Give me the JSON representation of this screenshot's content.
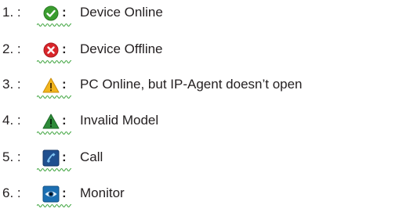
{
  "items": [
    {
      "number": "1. :",
      "icon": "check-circle-icon",
      "colon": ":",
      "label": "Device Online"
    },
    {
      "number": "2. :",
      "icon": "x-circle-icon",
      "colon": ":",
      "label": "Device Offline"
    },
    {
      "number": "3. :",
      "icon": "warning-icon",
      "colon": ":",
      "label": "PC Online, but IP-Agent doesn’t open"
    },
    {
      "number": "4. :",
      "icon": "invalid-model-icon",
      "colon": ":",
      "label": "Invalid Model"
    },
    {
      "number": "5. :",
      "icon": "phone-icon",
      "colon": ":",
      "label": "Call"
    },
    {
      "number": "6. :",
      "icon": "eye-icon",
      "colon": ":",
      "label": "Monitor"
    }
  ],
  "colors": {
    "text": "#231f20",
    "online": "#3a9d2f",
    "offline": "#d9252a",
    "warning": "#f2b51d",
    "invalid": "#2e8b3a",
    "call": "#1f4f8f",
    "monitor": "#1b6fb3",
    "squiggle": "#3aa23a"
  }
}
